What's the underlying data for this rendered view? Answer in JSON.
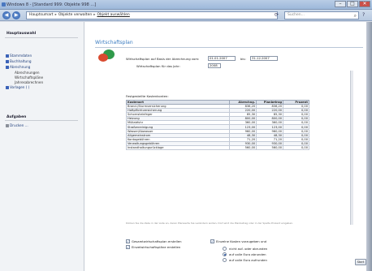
{
  "window": {
    "title": "Windows 8 - [Standard 999: Objekte 998 ...]",
    "buttons": [
      "–",
      "□",
      "✕"
    ]
  },
  "address": {
    "crumbs": [
      "Hauptsumart",
      "Objekte verwalten",
      "Objekt auswählen"
    ],
    "search_placeholder": "Suchen..."
  },
  "sidebar": {
    "section1_title": "Hauptauswahl",
    "items": [
      {
        "label": "Stammdaten",
        "sub": false
      },
      {
        "label": "Buchhaltung",
        "sub": false
      },
      {
        "label": "Abrechnung",
        "sub": false
      },
      {
        "label": "Abrechnungen",
        "sub": true
      },
      {
        "label": "Wirtschaftspläne",
        "sub": true
      },
      {
        "label": "Jahresabrechnen",
        "sub": true
      },
      {
        "label": "Vorlagen ( )",
        "sub": false
      }
    ],
    "section2_title": "Aufgaben",
    "tasks": [
      {
        "label": "Drucken ..."
      }
    ]
  },
  "content": {
    "heading": "Wirtschaftsplan",
    "basis_label": "Wirtschaftsplan auf Basis der Abrechnung vom:",
    "date_from": "01.01.2007",
    "bis_label": "bis:",
    "date_to": "31.12.2007",
    "year_label": "Wirtschaftsplan für das Jahr:",
    "year": "2008",
    "table_title": "Festgestellte Kostenkonten:",
    "columns": [
      "Kostenart",
      "Abrechng.",
      "Planbetrag",
      "Prozent"
    ],
    "rows": [
      [
        "Brand-/Sturmversicherung",
        "836,20",
        "836,20",
        "0,00"
      ],
      [
        "Haftpflichtversicherung",
        "220,00",
        "220,00",
        "0,00"
      ],
      [
        "Schornsteinfeger",
        "85,30",
        "85,30",
        "0,00"
      ],
      [
        "Heizung",
        "800,00",
        "800,00",
        "0,00"
      ],
      [
        "Müllabfuhr",
        "360,00",
        "360,00",
        "0,00"
      ],
      [
        "Straßenreinigung",
        "123,00",
        "123,00",
        "0,00"
      ],
      [
        "Wasser/Abwasser",
        "960,00",
        "960,00",
        "0,00"
      ],
      [
        "Allgemeinstrom",
        "48,30",
        "48,30",
        "0,00"
      ],
      [
        "Kontogebühren",
        "71,20",
        "71,20",
        "0,00"
      ],
      [
        "Verwaltungsgebühren",
        "930,00",
        "930,00",
        "0,00"
      ],
      [
        "Instandhaltungsrücklage",
        "560,00",
        "560,00",
        "0,00"
      ]
    ],
    "note": "Klicken Sie die Zeile in der Liste an, deren Planwerte Sie verändern wollen. Dort wird die Planbetrag oder in der Spalte Prozent eingeben.",
    "options": {
      "gesamt_label": "Gesamtwirtschaftsplan erstellen",
      "einzel_label": "Einzelwirtschaftspläne erstellen",
      "kosten_label": "Einzelne Kosten vorzugeben und",
      "radio": [
        "nicht auf- oder abrunden",
        "auf volle Euro abrunden",
        "auf volle Euro aufrunden"
      ]
    },
    "ok_button": "Start"
  }
}
